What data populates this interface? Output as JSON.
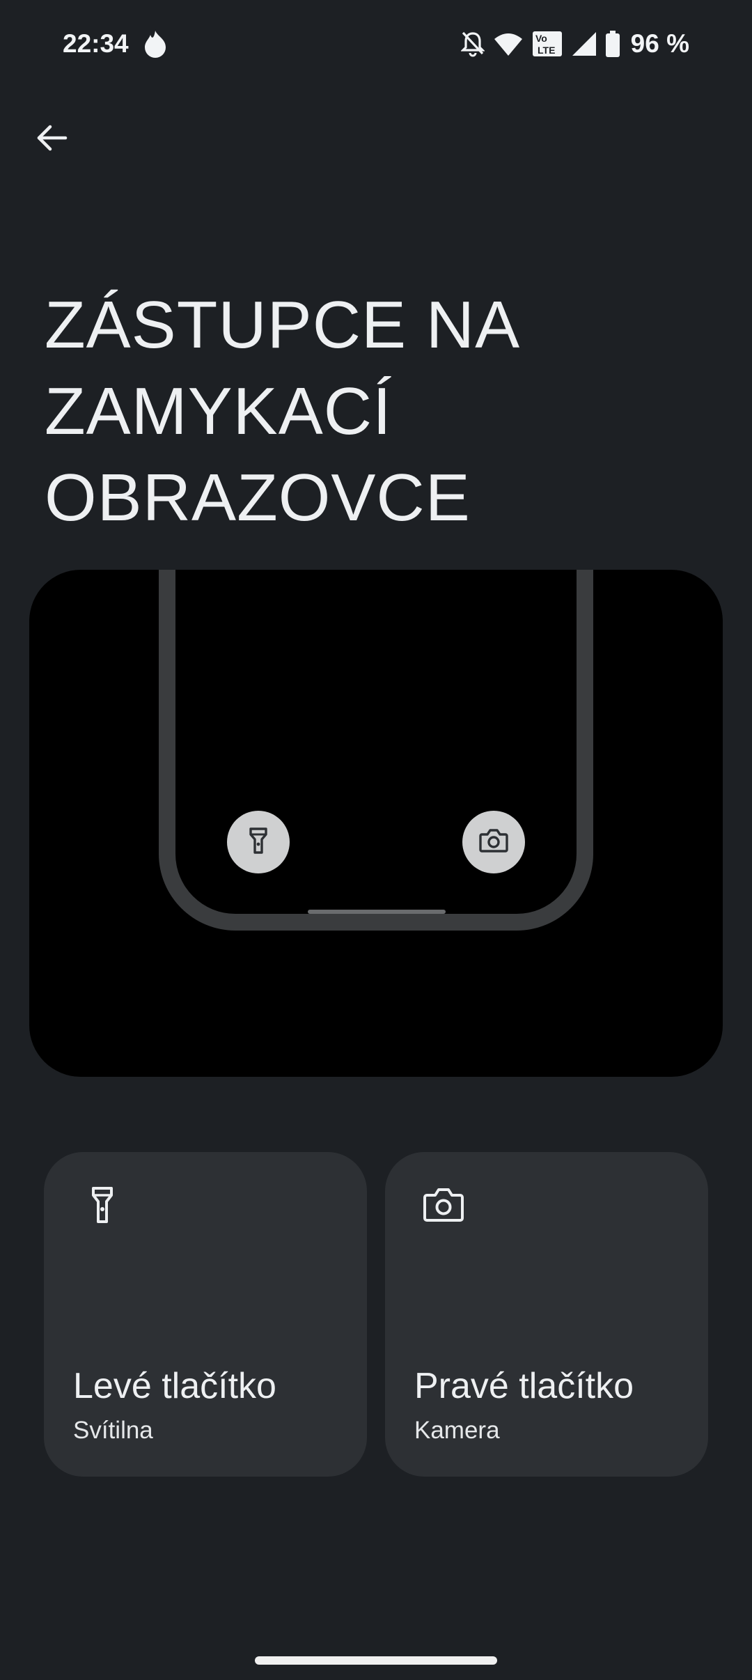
{
  "status_bar": {
    "time": "22:34",
    "left_icon": "flame-icon",
    "icons": [
      "bell-off-icon",
      "wifi-icon",
      "volte-icon",
      "signal-icon",
      "battery-icon"
    ],
    "volte_label_top": "Vo",
    "volte_label_bottom": "LTE",
    "battery": "96 %"
  },
  "header": {
    "back_icon": "arrow-left-icon",
    "title": "ZÁSTUPCE NA ZAMYKACÍ OBRAZOVCE"
  },
  "preview": {
    "left_shortcut_icon": "flashlight-icon",
    "right_shortcut_icon": "camera-icon"
  },
  "cards": [
    {
      "icon": "flashlight-icon",
      "title": "Levé tlačítko",
      "subtitle": "Svítilna"
    },
    {
      "icon": "camera-icon",
      "title": "Pravé tlačítko",
      "subtitle": "Kamera"
    }
  ],
  "colors": {
    "background": "#1d2024",
    "card": "#2d3034",
    "preview_background": "#000000",
    "preview_button": "#cfd0d1",
    "text": "#eef0f2"
  }
}
